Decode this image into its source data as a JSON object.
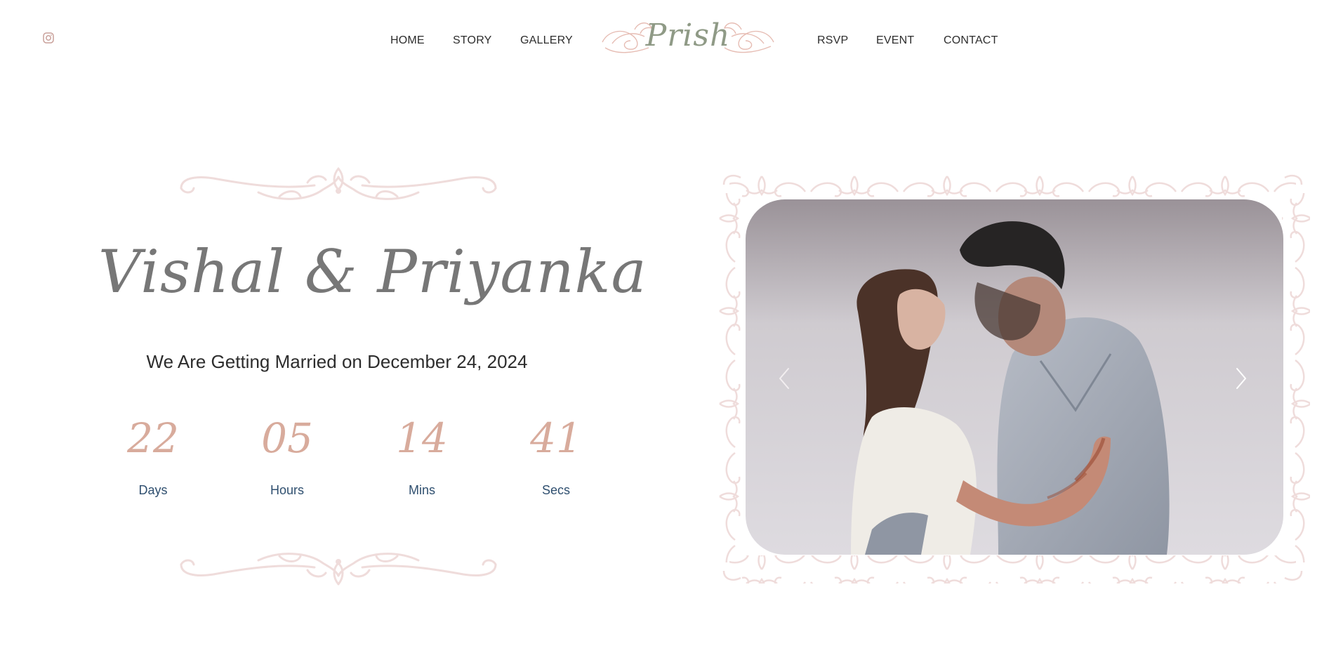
{
  "header": {
    "social_icon": "instagram-icon",
    "nav_left": [
      "HOME",
      "STORY",
      "GALLERY"
    ],
    "logo_text": "Prish",
    "nav_right": [
      "RSVP",
      "EVENT",
      "CONTACT"
    ]
  },
  "hero": {
    "names": "Vishal & Priyanka",
    "tagline": "We Are Getting Married on December 24, 2024",
    "countdown": [
      {
        "value": "22",
        "label": "Days"
      },
      {
        "value": "05",
        "label": "Hours"
      },
      {
        "value": "14",
        "label": "Mins"
      },
      {
        "value": "41",
        "label": "Secs"
      }
    ]
  },
  "carousel": {
    "prev_icon": "chevron-left-icon",
    "next_icon": "chevron-right-icon"
  },
  "colors": {
    "accent": "#d8ab9c",
    "ornament": "#efdcdb",
    "logo_green": "#8f9a86",
    "label_blue": "#2f4f6f",
    "text_dark": "#2d2d2d",
    "names_gray": "#777777"
  }
}
